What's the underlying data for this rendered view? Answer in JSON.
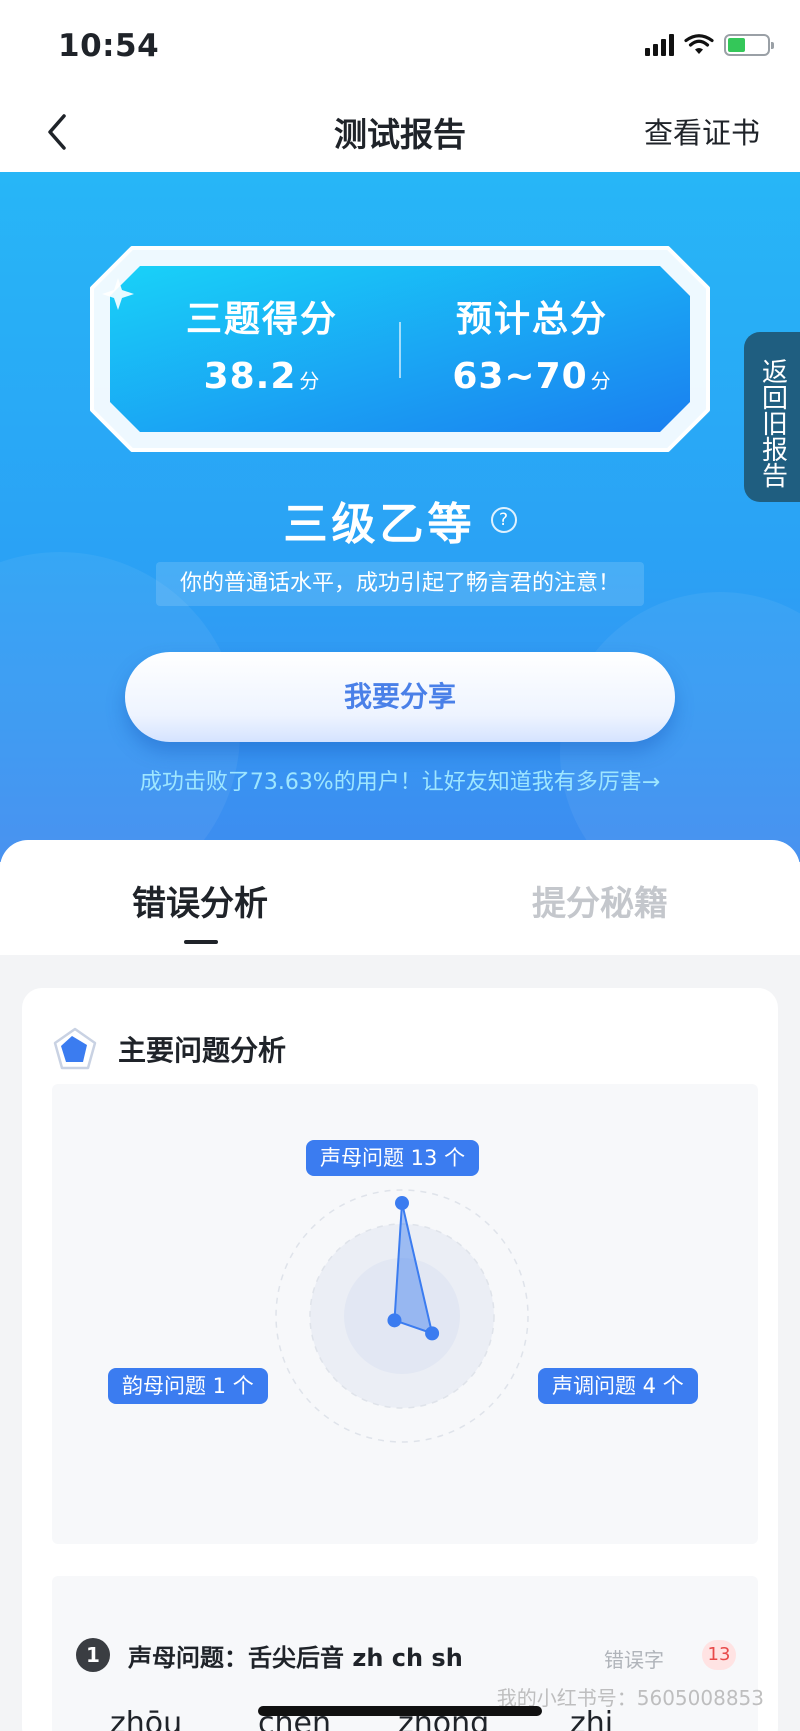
{
  "status_bar": {
    "time": "10:54"
  },
  "nav": {
    "title": "测试报告",
    "action": "查看证书"
  },
  "hero": {
    "scores": [
      {
        "label": "三题得分",
        "value": "38.2",
        "unit": "分"
      },
      {
        "label": "预计总分",
        "value": "63~70",
        "unit": "分"
      }
    ],
    "side_tab": "返回旧报告",
    "level": "三级乙等",
    "help": "?",
    "description": "你的普通话水平，成功引起了畅言君的注意！",
    "share_button": "我要分享",
    "share_hint": "成功击败了73.63%的用户！让好友知道我有多厉害→"
  },
  "tabs": [
    {
      "label": "错误分析",
      "active": true
    },
    {
      "label": "提分秘籍",
      "active": false
    }
  ],
  "card": {
    "title": "主要问题分析",
    "chart": {
      "tags": {
        "initials": "声母问题 13 个",
        "finals": "韵母问题 1 个",
        "tones": "声调问题 4 个"
      }
    },
    "problem": {
      "index": "1",
      "title": "声母问题：舌尖后音 zh ch sh",
      "count_label": "错误字",
      "count": "13",
      "pinyin": [
        "zhōu",
        "chēn",
        "zhōng",
        "zhi"
      ]
    }
  },
  "chart_data": {
    "type": "radar",
    "categories": [
      "声母问题",
      "声调问题",
      "韵母问题"
    ],
    "values": [
      13,
      4,
      1
    ],
    "title": "主要问题分析",
    "color": "#3b7cf0"
  },
  "watermark": "我的小红书号：5605008853"
}
